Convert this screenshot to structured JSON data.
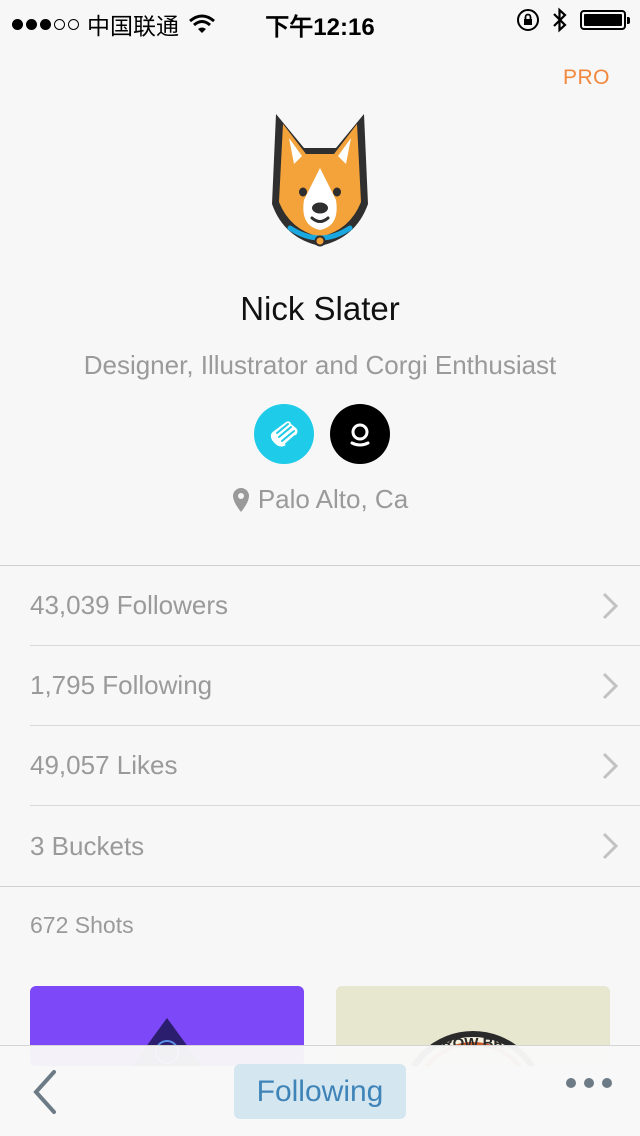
{
  "status_bar": {
    "carrier": "中国联通",
    "time": "下午12:16"
  },
  "profile": {
    "pro_label": "PRO",
    "name": "Nick Slater",
    "bio": "Designer, Illustrator and Corgi Enthusiast",
    "location": "Palo Alto, Ca"
  },
  "stats": [
    {
      "label": "43,039 Followers"
    },
    {
      "label": "1,795 Following"
    },
    {
      "label": "49,057 Likes"
    },
    {
      "label": "3 Buckets"
    }
  ],
  "shots": {
    "count_label": "672 Shots",
    "thumbnail_text": "ROW BR"
  },
  "tab_bar": {
    "follow_label": "Following"
  },
  "colors": {
    "accent_orange": "#f0883e",
    "follow_blue": "#3f84b8",
    "dribbble_cyan": "#1ecbe8",
    "shot_purple": "#7d48f7"
  }
}
